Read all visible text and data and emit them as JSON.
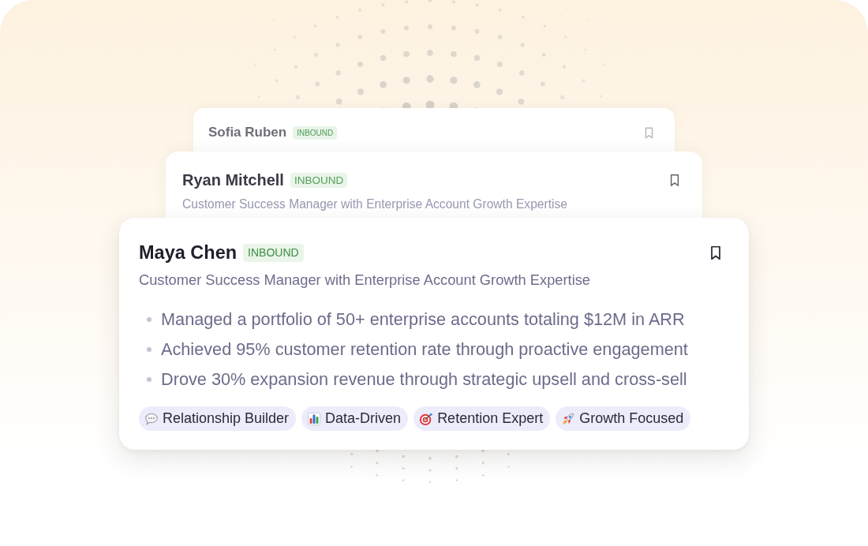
{
  "candidates": [
    {
      "name": "Sofia Ruben",
      "badge": "INBOUND"
    },
    {
      "name": "Ryan Mitchell",
      "badge": "INBOUND",
      "headline": "Customer Success Manager with Enterprise Account Growth Expertise"
    },
    {
      "name": "Maya Chen",
      "badge": "INBOUND",
      "headline": "Customer Success Manager with Enterprise Account Growth Expertise",
      "highlights": [
        "Managed a portfolio of 50+ enterprise accounts totaling $12M in ARR",
        "Achieved 95% customer retention rate through proactive engagement",
        "Drove 30% expansion revenue through strategic upsell and cross-sell"
      ],
      "tags": [
        {
          "label": "Relationship Builder",
          "kind": "speech"
        },
        {
          "label": "Data-Driven",
          "kind": "chart"
        },
        {
          "label": "Retention Expert",
          "kind": "target"
        },
        {
          "label": "Growth Focused",
          "kind": "rocket"
        }
      ]
    }
  ]
}
